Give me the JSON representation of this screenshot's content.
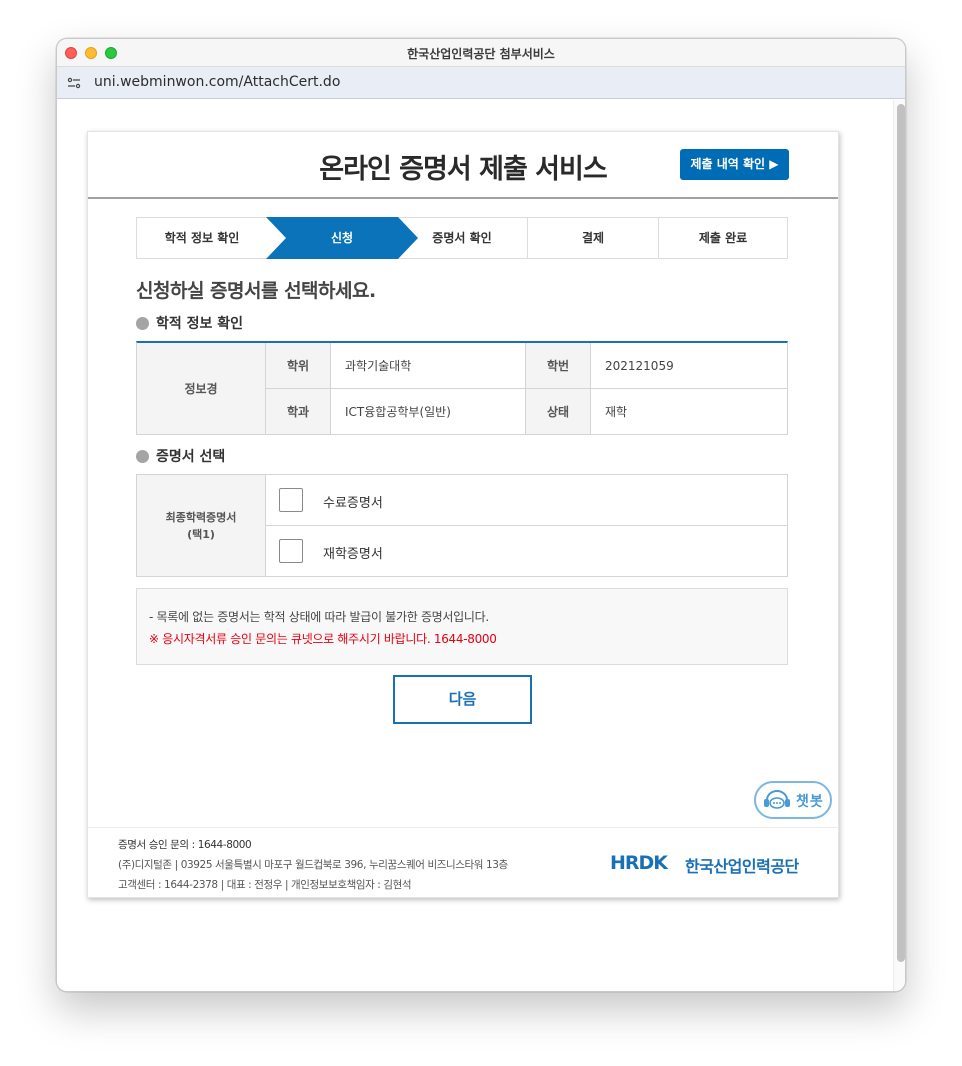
{
  "window": {
    "title": "한국산업인력공단 첨부서비스"
  },
  "address_bar": {
    "url": "uni.webminwon.com/AttachCert.do"
  },
  "header": {
    "title": "온라인 증명서 제출 서비스",
    "history_button": "제출 내역 확인 ▶"
  },
  "steps": [
    {
      "label": "학적 정보 확인"
    },
    {
      "label": "신청"
    },
    {
      "label": "증명서 확인"
    },
    {
      "label": "결제"
    },
    {
      "label": "제출 완료"
    }
  ],
  "main": {
    "instruction": "신청하실 증명서를 선택하세요.",
    "academic_section_title": "학적 정보 확인",
    "academic": {
      "name": "정보경",
      "college_label": "학위",
      "college_value": "과학기술대학",
      "student_no_label": "학번",
      "student_no_value": "202121059",
      "department_label": "학과",
      "department_value": "ICT융합공학부(일반)",
      "status_label": "상태",
      "status_value": "재학"
    },
    "cert_section_title": "증명서 선택",
    "cert_group": {
      "label_line1": "최종학력증명서",
      "label_line2": "(택1)"
    },
    "certificates": [
      {
        "label": "수료증명서",
        "checked": false
      },
      {
        "label": "재학증명서",
        "checked": false
      }
    ],
    "notice_line1": "- 목록에 없는 증명서는 학적 상태에 따라 발급이 불가한 증명서입니다.",
    "notice_line2": "※ 응시자격서류 승인 문의는 큐넷으로 해주시기 바랍니다. 1644-8000",
    "next_button": "다음"
  },
  "chatbot": {
    "label": "챗봇"
  },
  "footer": {
    "line1": "증명서 승인 문의 : 1644-8000",
    "line2": "(주)디지털존 | 03925 서울특별시 마포구 월드컵북로 396, 누리꿈스퀘어 비즈니스타워 13층",
    "line3": "고객센터 : 1644-2378 | 대표 : 전정우 | 개인정보보호책임자 : 김현석",
    "logo_mark": "HRDK",
    "logo_text": "한국산업인력공단"
  },
  "colors": {
    "primary": "#006cb5",
    "step_active": "#0a73b9",
    "notice_red": "#e60012"
  }
}
